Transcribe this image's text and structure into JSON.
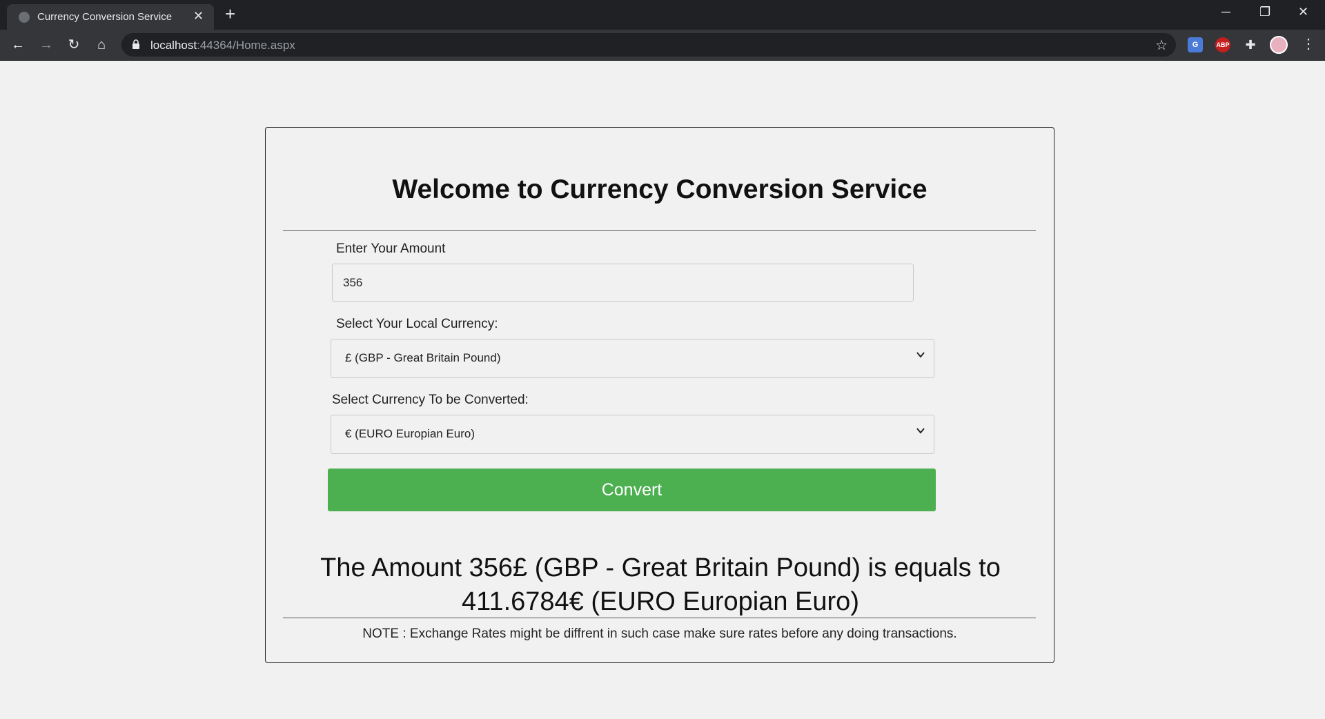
{
  "browser": {
    "tab_title": "Currency Conversion Service",
    "url_host": "localhost",
    "url_rest": ":44364/Home.aspx",
    "icons": [
      "back-icon",
      "forward-icon",
      "reload-icon",
      "home-icon",
      "lock-icon",
      "star-icon",
      "translate-icon",
      "adblock-icon",
      "extensions-icon",
      "profile-avatar",
      "menu-icon"
    ],
    "ext_translate": "G",
    "ext_abp": "ABP"
  },
  "page": {
    "heading": "Welcome to Currency Conversion Service",
    "amount_label": "Enter Your Amount",
    "amount_value": "356",
    "local_currency_label": "Select Your Local Currency:",
    "local_currency_value": "£ (GBP - Great Britain Pound)",
    "target_currency_label": "Select Currency To be Converted:",
    "target_currency_value": "€ (EURO Europian Euro)",
    "convert_label": "Convert",
    "result_text": "The Amount 356£ (GBP - Great Britain Pound) is equals to 411.6784€ (EURO Europian Euro)",
    "note": "NOTE : Exchange Rates might be diffrent in such case make sure rates before any doing transactions."
  },
  "colors": {
    "button": "#4caf50",
    "page_bg": "#f1f1f1",
    "chrome_dark": "#202124",
    "chrome_toolbar": "#35363a"
  }
}
